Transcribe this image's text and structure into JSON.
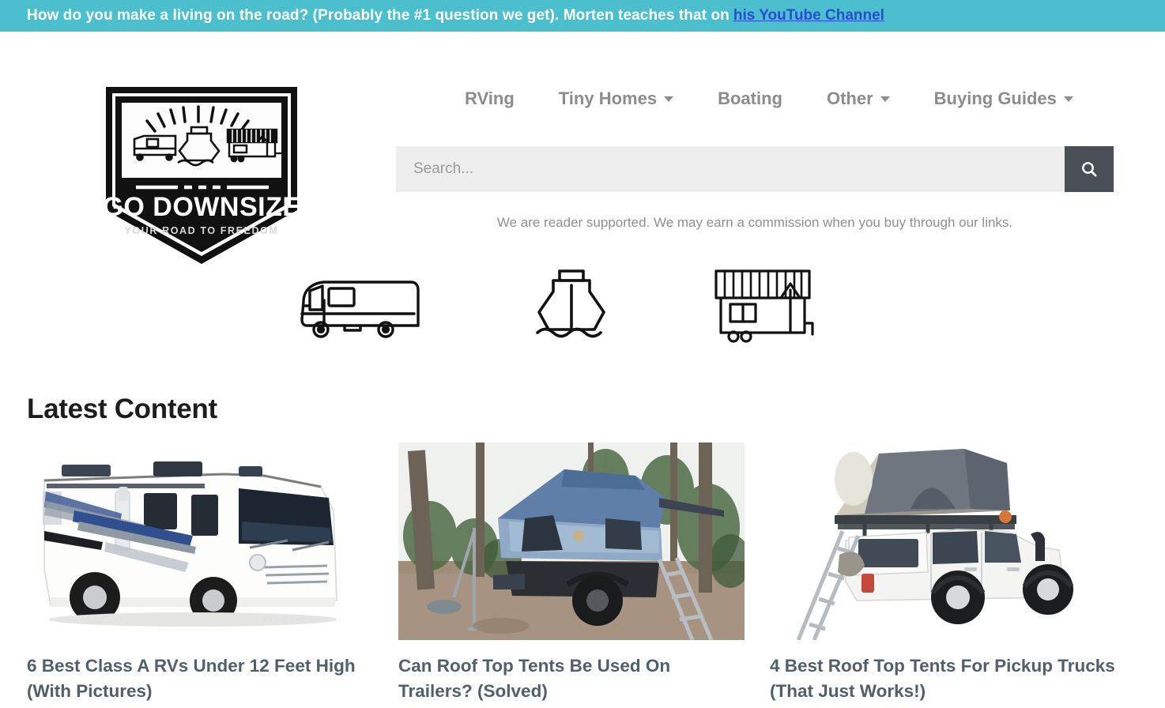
{
  "banner": {
    "text": "How do you make a living on the road? (Probably the #1 question we get). Morten teaches that on",
    "link_label": "his YouTube Channel",
    "bg_color": "#4cbfce",
    "link_color": "#2a4bd7"
  },
  "logo": {
    "name": "GO DOWNSIZE",
    "tagline": "YOUR ROAD TO FREEDOM",
    "alt": "go-downsize-logo"
  },
  "nav": {
    "items": [
      {
        "label": "RVing",
        "has_dropdown": false,
        "icon": ""
      },
      {
        "label": "Tiny Homes",
        "has_dropdown": true,
        "icon": "chevron-down-icon"
      },
      {
        "label": "Boating",
        "has_dropdown": false,
        "icon": ""
      },
      {
        "label": "Other",
        "has_dropdown": true,
        "icon": "chevron-down-icon"
      },
      {
        "label": "Buying Guides",
        "has_dropdown": true,
        "icon": "chevron-down-icon"
      }
    ]
  },
  "search": {
    "placeholder": "Search...",
    "value": "",
    "button_icon": "search-icon",
    "button_color": "#4a4f57",
    "field_color": "#eeeeee"
  },
  "disclaimer": "We are reader supported. We may earn a commission when you buy through our links.",
  "categories": [
    {
      "id": "rv",
      "icon": "rv-icon",
      "label": "RV"
    },
    {
      "id": "boat",
      "icon": "boat-icon",
      "label": "Boat"
    },
    {
      "id": "tiny",
      "icon": "tiny-home-icon",
      "label": "Tiny Home"
    }
  ],
  "latest": {
    "heading": "Latest Content",
    "cards": [
      {
        "title": "6 Best Class A RVs Under 12 Feet High (With Pictures)",
        "image_alt": "white-class-a-motorhome-photo"
      },
      {
        "title": "Can Roof Top Tents Be Used On Trailers? (Solved)",
        "image_alt": "blue-roof-top-tent-on-trailer-photo"
      },
      {
        "title": "4 Best Roof Top Tents For Pickup Trucks (That Just Works!)",
        "image_alt": "pickup-truck-with-roof-top-tent-photo"
      }
    ]
  }
}
